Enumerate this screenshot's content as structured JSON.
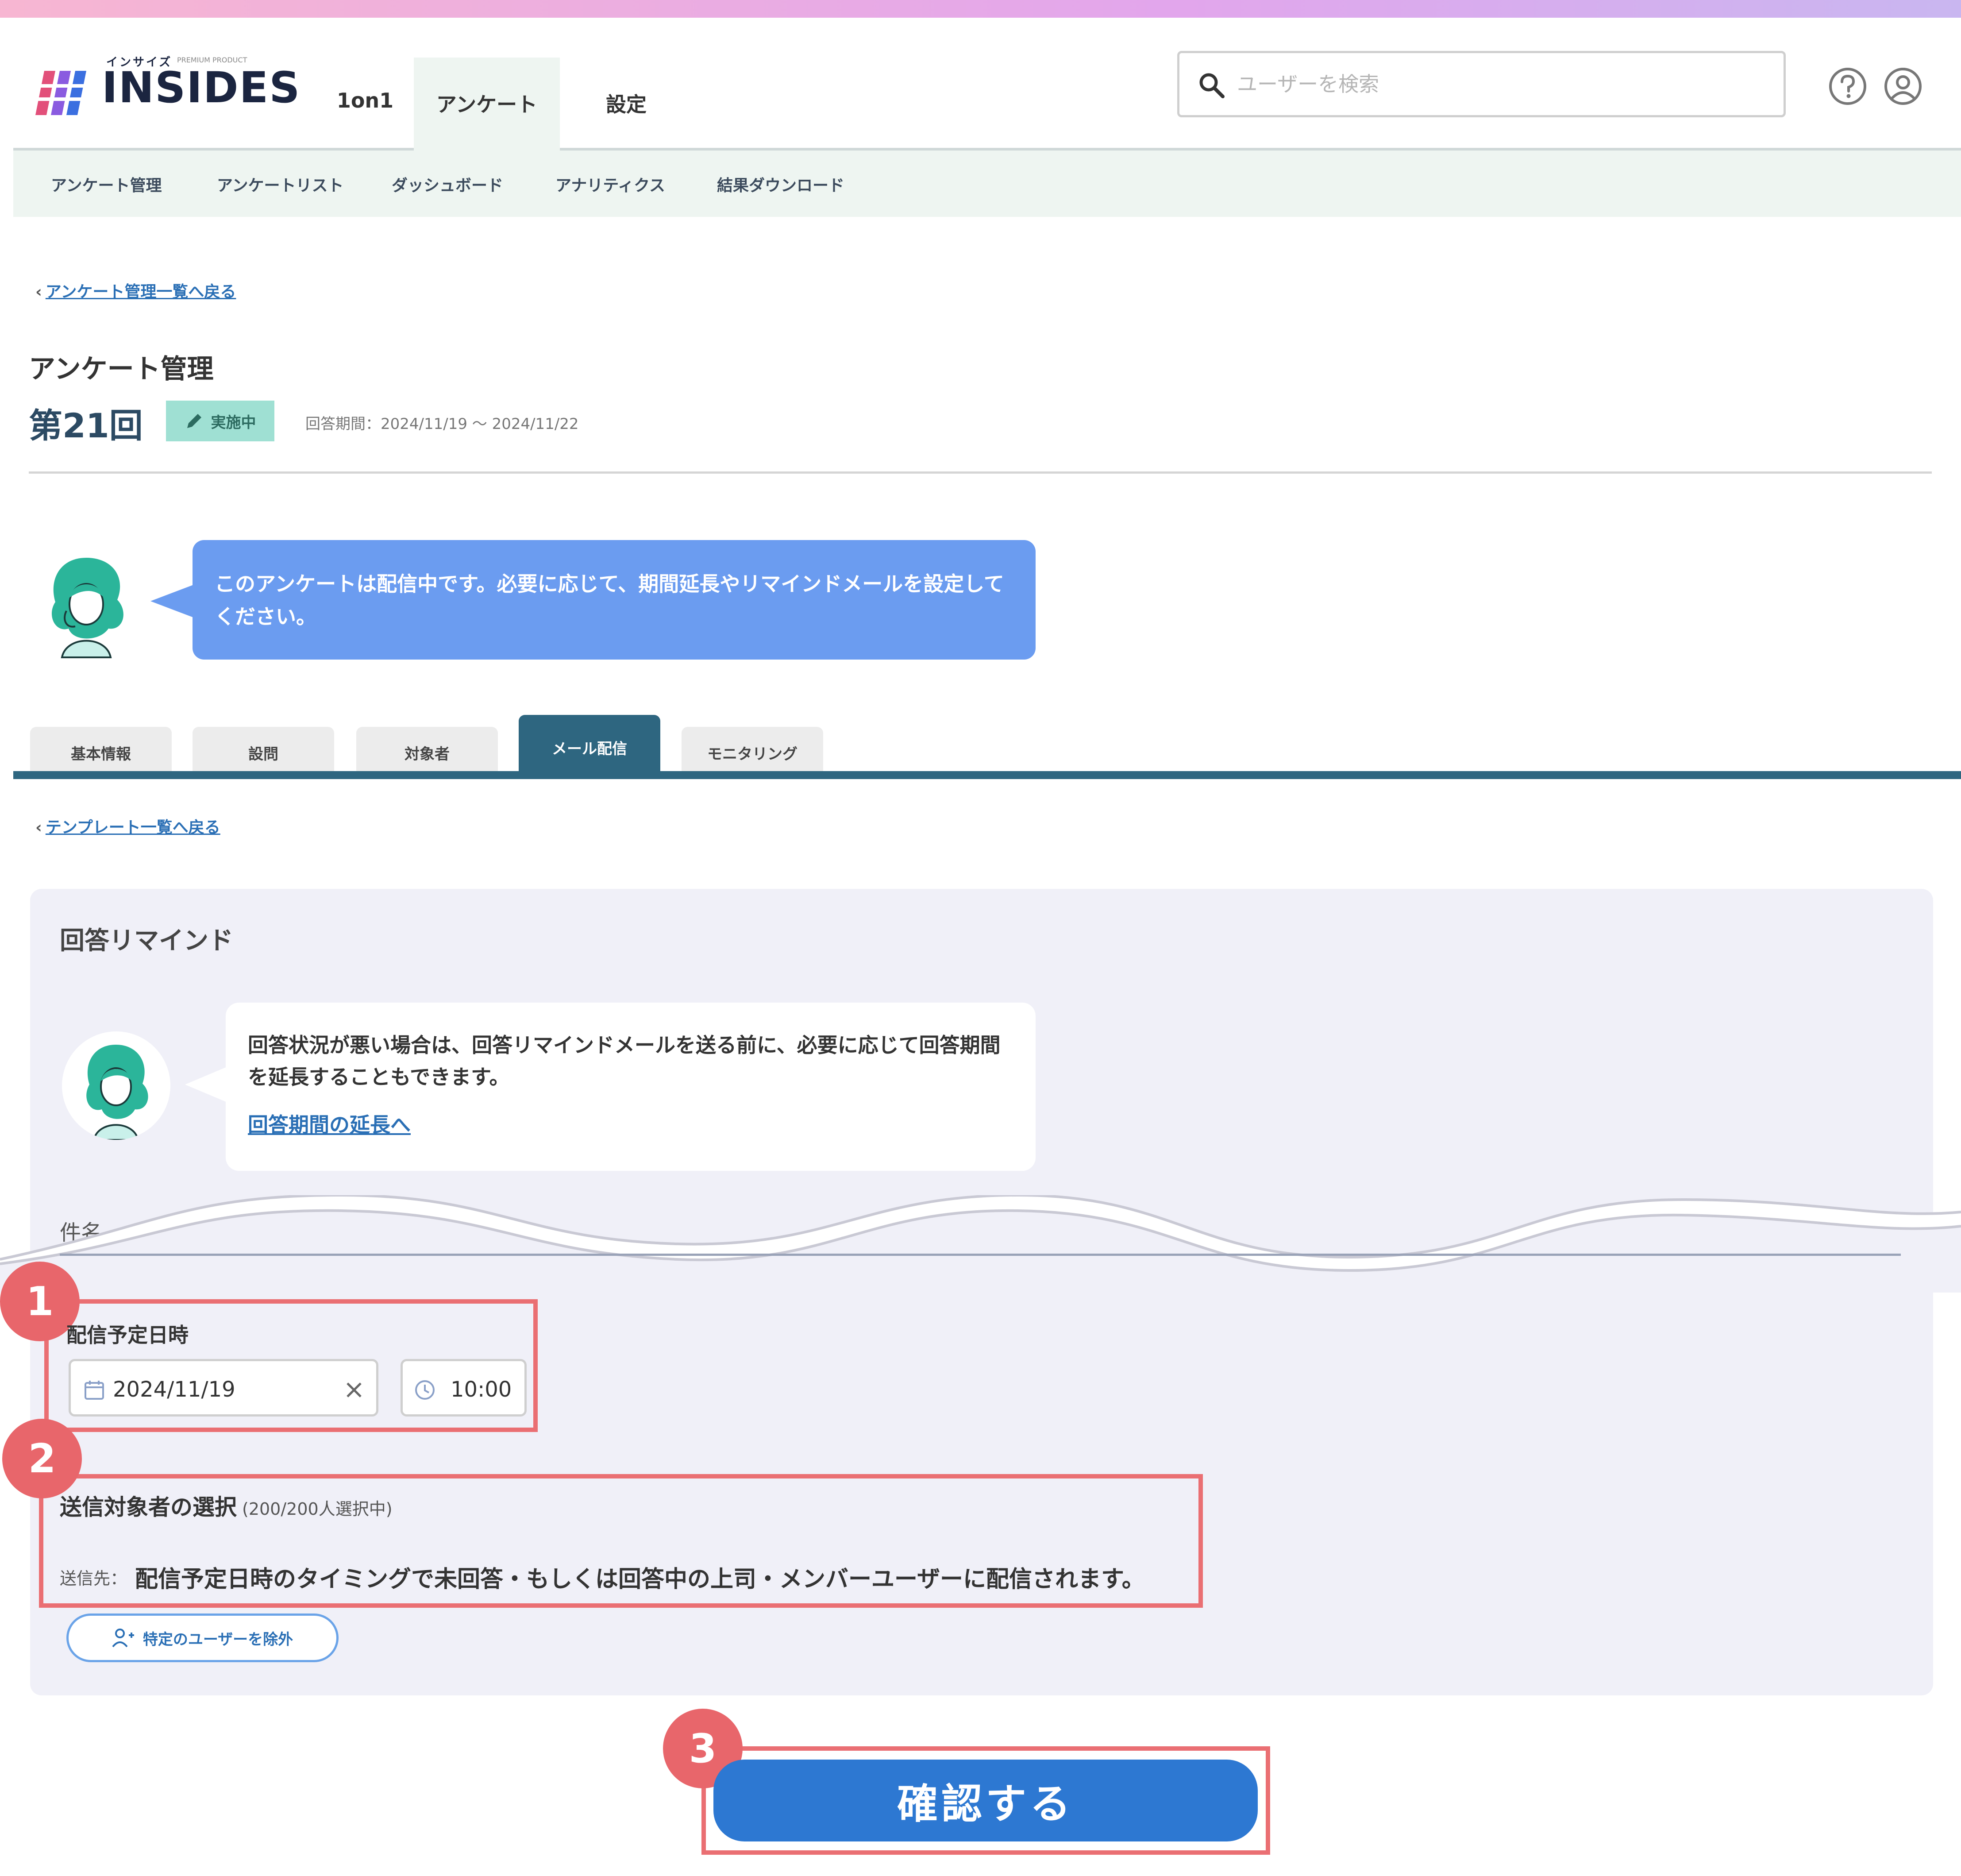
{
  "header": {
    "logo": {
      "small_text": "インサイズ",
      "small_text2": "PREMIUM PRODUCT",
      "text": "INSIDES"
    },
    "nav": [
      {
        "label": "1on1"
      },
      {
        "label": "アンケート"
      },
      {
        "label": "設定"
      }
    ],
    "search": {
      "placeholder": "ユーザーを検索"
    },
    "icons": {
      "help": "help-icon",
      "user": "user-icon"
    }
  },
  "subnav": {
    "items": [
      {
        "label": "アンケート管理"
      },
      {
        "label": "アンケートリスト"
      },
      {
        "label": "ダッシュボード"
      },
      {
        "label": "アナリティクス"
      },
      {
        "label": "結果ダウンロード"
      }
    ]
  },
  "breadcrumb": {
    "back_to_survey_list": "アンケート管理一覧へ戻る"
  },
  "page": {
    "title": "アンケート管理",
    "round": "第21回",
    "status": "実施中",
    "period": "回答期間：2024/11/19 ～ 2024/11/22"
  },
  "info_bubble": {
    "text": "このアンケートは配信中です。必要に応じて、期間延長やリマインドメールを設定してください。"
  },
  "tabs": [
    {
      "label": "基本情報"
    },
    {
      "label": "設問"
    },
    {
      "label": "対象者"
    },
    {
      "label": "メール配信"
    },
    {
      "label": "モニタリング"
    }
  ],
  "template_back": "テンプレート一覧へ戻る",
  "remind": {
    "title": "回答リマインド",
    "bubble_text": "回答状況が悪い場合は、回答リマインドメールを送る前に、必要に応じて回答期間を延長することもできます。",
    "extend_link": "回答期間の延長へ",
    "subject_label": "件名",
    "schedule": {
      "label": "配信予定日時",
      "date": "2024/11/19",
      "time": "10:00"
    },
    "recipients": {
      "title": "送信対象者の選択",
      "count": "(200/200人選択中)",
      "prefix": "送信先：",
      "text": "配信予定日時のタイミングで未回答・もしくは回答中の上司・メンバーユーザーに配信されます。"
    },
    "exclude_button": "特定のユーザーを除外"
  },
  "confirm_button": "確認する",
  "markers": [
    "1",
    "2",
    "3"
  ],
  "colors": {
    "accent_blue": "#2d78d2",
    "tab_active": "#2e6680",
    "highlight": "#ea6f73",
    "bubble_blue": "#6b9cf0",
    "status_badge": "#9fe0d3"
  }
}
